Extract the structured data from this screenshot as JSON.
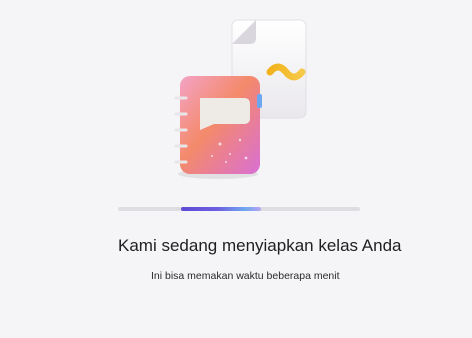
{
  "loading": {
    "illustration_icon": "notebook-with-document-icon",
    "progress_fraction_start": 0.26,
    "progress_fraction_end": 0.59,
    "title": "Kami sedang menyiapkan kelas Anda",
    "subtitle": "Ini bisa memakan waktu beberapa menit"
  },
  "colors": {
    "background": "#f5f4f6",
    "track": "#dedde2",
    "accent": "#5b4bd6"
  }
}
